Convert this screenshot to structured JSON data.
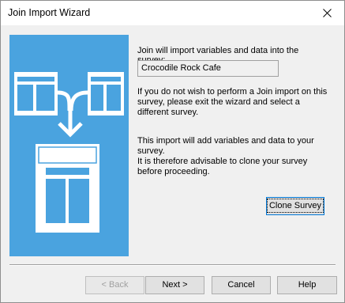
{
  "window": {
    "title": "Join Import Wizard",
    "close_glyph": "close-icon"
  },
  "content": {
    "intro": "Join will import variables and data into the survey:",
    "survey_name": "Crocodile Rock Cafe",
    "message1": "If you do not wish to perform a Join import on this survey, please exit the wizard and select a different survey.",
    "message2": "This import will add variables and data to your survey.\nIt is therefore advisable to clone your survey before proceeding.",
    "clone_label": "Clone Survey"
  },
  "buttons": {
    "back": "< Back",
    "next": "Next >",
    "cancel": "Cancel",
    "help": "Help"
  },
  "colors": {
    "illustration_bg": "#4aa3df",
    "illustration_fg": "#ffffff",
    "focus_border": "#0078d7"
  }
}
